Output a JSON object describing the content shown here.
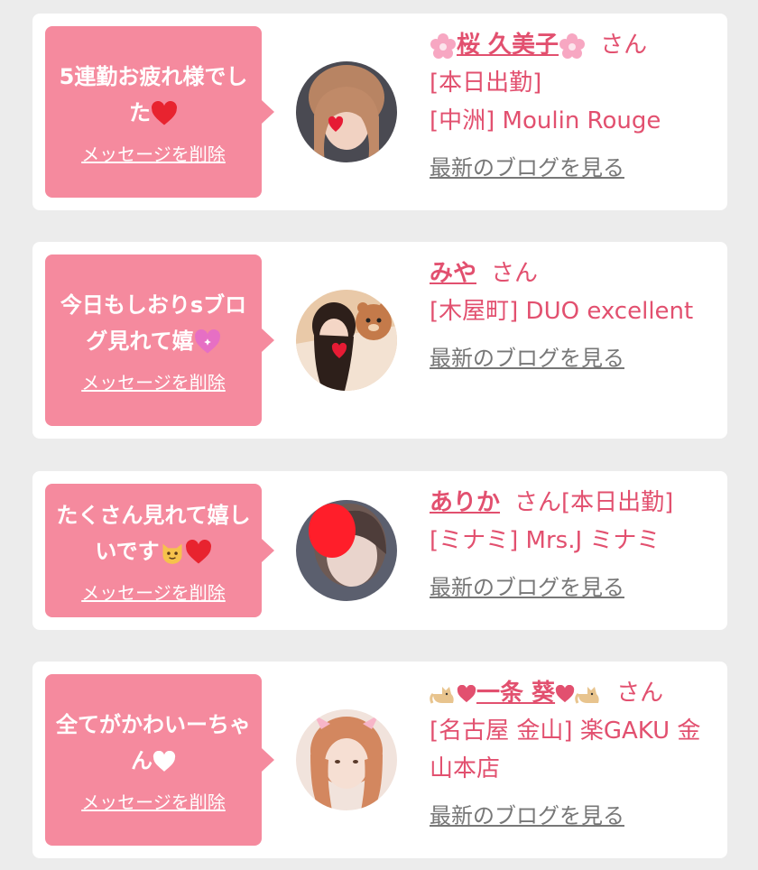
{
  "colors": {
    "background": "#ececec",
    "card": "#ffffff",
    "bubble": "#f58a9e",
    "accent_text": "#e2506f",
    "link_gray": "#777777"
  },
  "cards": [
    {
      "message": "5連勤お疲れ様でした",
      "message_emoji": "red-heart-icon",
      "delete_label": "メッセージを削除",
      "name": "桜 久美子",
      "name_decor": "cherry-blossom-icon",
      "honorific": "さん",
      "details": [
        "[本日出勤]",
        "[中洲] Moulin Rouge"
      ],
      "blog_link": "最新のブログを見る"
    },
    {
      "message": "今日もしおりsブログ見れて嬉",
      "message_emoji": "sparkling-heart-icon",
      "delete_label": "メッセージを削除",
      "name": "みや",
      "honorific": "さん",
      "details": [
        "[木屋町] DUO excellent"
      ],
      "blog_link": "最新のブログを見る"
    },
    {
      "message": "たくさん見れて嬉しいです",
      "message_emoji": "cat-face-and-heart-icon",
      "delete_label": "メッセージを削除",
      "name": "ありか",
      "honorific": "さん[本日出勤]",
      "details": [
        "[ミナミ] Mrs.J ミナミ"
      ],
      "blog_link": "最新のブログを見る"
    },
    {
      "message": "全てがかわいーちゃん",
      "message_emoji": "white-heart-icon",
      "delete_label": "メッセージを削除",
      "name": "一条 葵",
      "name_decor": "cat-and-heart-icon",
      "honorific": "さん",
      "details": [
        "[名古屋 金山] 楽GAKU 金山本店"
      ],
      "blog_link": "最新のブログを見る"
    }
  ]
}
